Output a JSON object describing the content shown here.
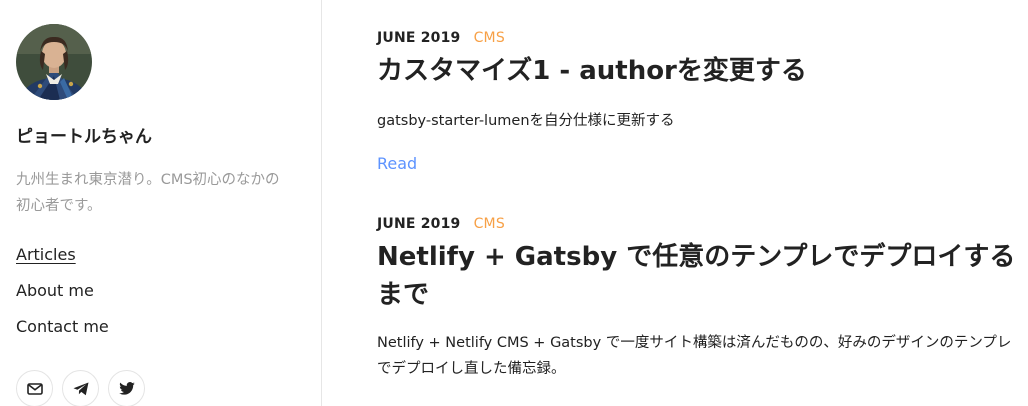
{
  "sidebar": {
    "author": {
      "name": "ピョートルちゃん",
      "bio": "九州生まれ東京潜り。CMS初心のなかの初心者です。"
    },
    "nav": [
      {
        "label": "Articles",
        "active": true
      },
      {
        "label": "About me",
        "active": false
      },
      {
        "label": "Contact me",
        "active": false
      }
    ],
    "contacts": [
      {
        "icon": "mail-icon"
      },
      {
        "icon": "telegram-icon"
      },
      {
        "icon": "twitter-icon"
      }
    ]
  },
  "posts": [
    {
      "date": "JUNE 2019",
      "category": "CMS",
      "title": "カスタマイズ1 - authorを変更する",
      "description": "gatsby-starter-lumenを自分仕様に更新する",
      "read_label": "Read"
    },
    {
      "date": "JUNE 2019",
      "category": "CMS",
      "title": "Netlify + Gatsby で任意のテンプレでデプロイするまで",
      "description": "Netlify + Netlify CMS + Gatsby で一度サイト構築は済んだものの、好みのデザインのテンプレでデプロイし直した備忘録。"
    }
  ],
  "colors": {
    "accent_category": "#f7a046",
    "link": "#5d93ff",
    "muted_text": "#9a9a9a",
    "border": "#e6e6e6"
  }
}
